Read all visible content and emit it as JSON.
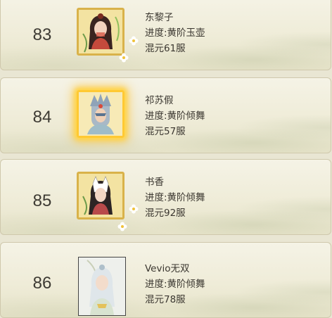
{
  "leaderboard": {
    "entries": [
      {
        "rank": "83",
        "name": "东黎子",
        "progress": "进度:黄阶玉壶",
        "server": "混元61服",
        "frame": "gold",
        "avatar_icon": "female-cultivator-portrait-icon"
      },
      {
        "rank": "84",
        "name": "祁苏假",
        "progress": "进度:黄阶倾舞",
        "server": "混元57服",
        "frame": "gold-glow",
        "avatar_icon": "masked-cultivator-portrait-icon"
      },
      {
        "rank": "85",
        "name": "书香",
        "progress": "进度:黄阶倾舞",
        "server": "混元92服",
        "frame": "gold",
        "avatar_icon": "fox-mask-cultivator-portrait-icon"
      },
      {
        "rank": "86",
        "name": "Vevio无双",
        "progress": "进度:黄阶倾舞",
        "server": "混元78服",
        "frame": "plain",
        "avatar_icon": "white-hair-cultivator-portrait-icon"
      }
    ]
  },
  "colors": {
    "row_background": "#f2efdf",
    "gold_frame": "#d9b24a",
    "glow": "#ffd64a",
    "text": "#3b3730"
  }
}
